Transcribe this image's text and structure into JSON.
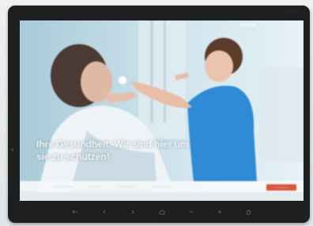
{
  "device": {
    "brand": "· · · · ·"
  },
  "hero": {
    "logo": "KLINIK",
    "headline_line1": "Ihre Gesundheit: Wir sind hier um",
    "headline_line2": "sie zu schützen!"
  },
  "nav": {
    "items": [
      "———————",
      "————",
      "——————",
      "———————"
    ],
    "cta": "—————"
  },
  "controls": {
    "icons": [
      "back-icon",
      "previous-icon",
      "next-icon",
      "home-icon",
      "volume-down-icon",
      "volume-up-icon",
      "power-icon"
    ]
  },
  "colors": {
    "bezel": "#1d1f21",
    "sky": "#bcd6e2",
    "cta": "#d9543c"
  }
}
